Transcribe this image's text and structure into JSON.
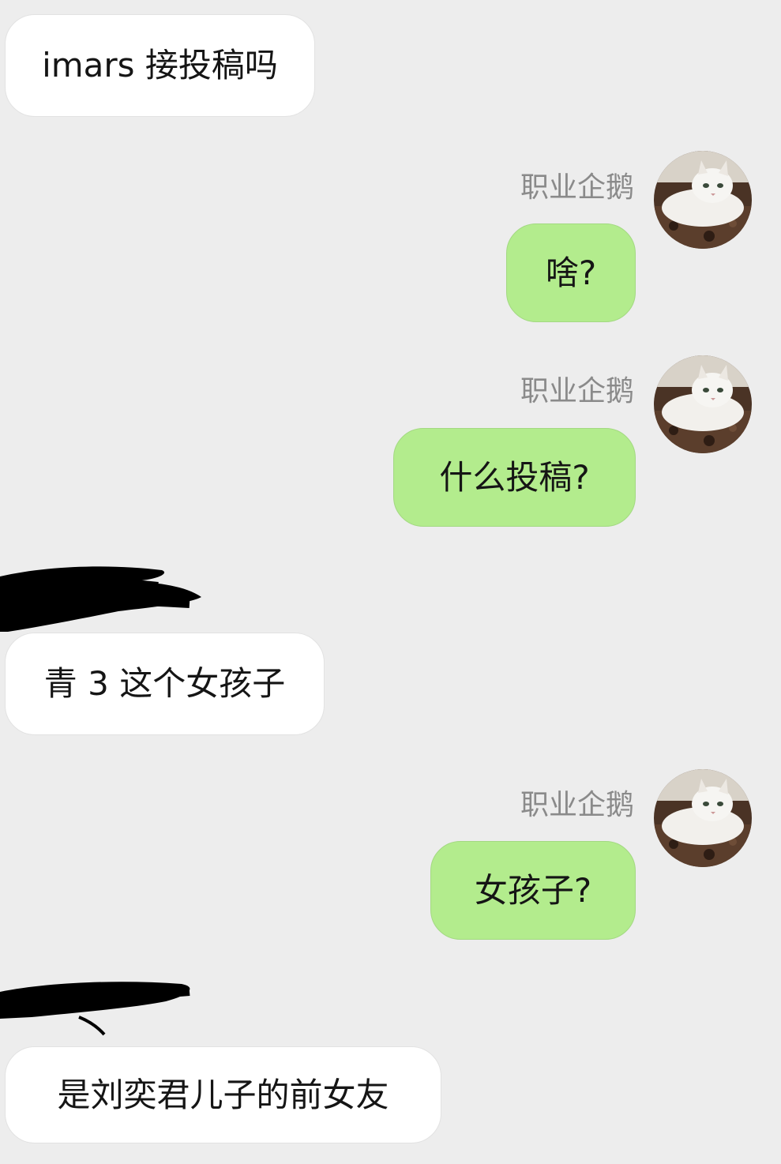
{
  "messages": [
    {
      "direction": "incoming",
      "text": "imars 接投稿吗"
    },
    {
      "direction": "outgoing",
      "sender": "职业企鹅",
      "text": "啥?"
    },
    {
      "direction": "outgoing",
      "sender": "职业企鹅",
      "text": "什么投稿?"
    },
    {
      "direction": "incoming",
      "sender_redacted": true,
      "text": "青 3 这个女孩子"
    },
    {
      "direction": "outgoing",
      "sender": "职业企鹅",
      "text": "女孩子?"
    },
    {
      "direction": "incoming",
      "sender_redacted": true,
      "text": "是刘奕君儿子的前女友"
    }
  ],
  "colors": {
    "background": "#ededed",
    "incoming_bubble": "#ffffff",
    "outgoing_bubble": "#b3ec8d",
    "sender_name": "#8a8a8a",
    "redaction": "#000000"
  },
  "icons": {
    "avatar": "cat-avatar-icon"
  }
}
